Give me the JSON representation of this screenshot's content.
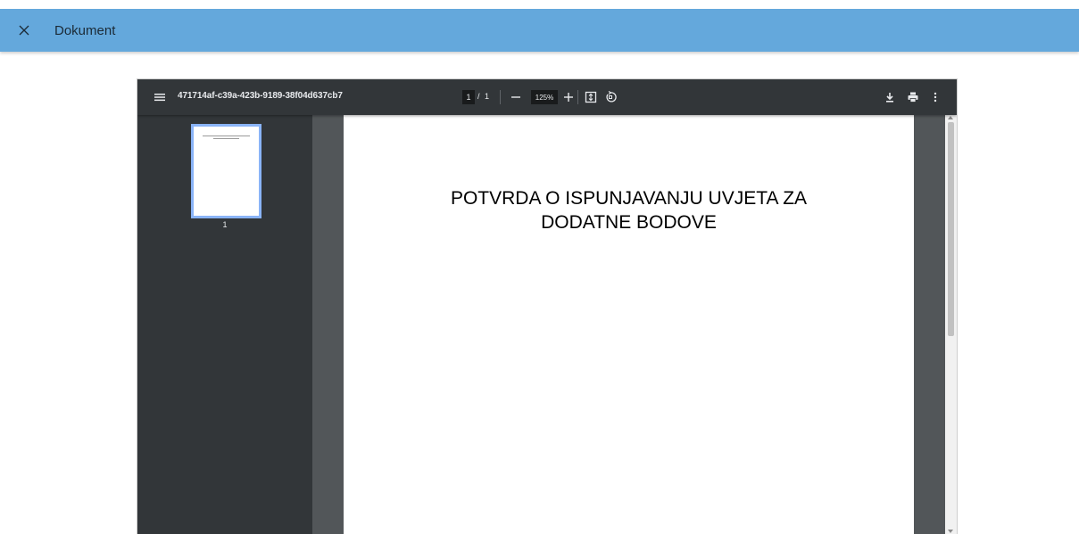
{
  "header": {
    "title": "Dokument",
    "close_icon": "close-icon",
    "background_color": "#64a8dc"
  },
  "viewer": {
    "document_name": "471714af-c39a-423b-9189-38f04d637cb7",
    "current_page": "1",
    "page_separator": "/",
    "total_pages": "1",
    "zoom": "125%",
    "icons": [
      "menu-icon",
      "zoom-out-icon",
      "zoom-in-icon",
      "fit-to-page-icon",
      "rotate-icon",
      "download-icon",
      "print-icon",
      "more-vert-icon"
    ],
    "thumbnail_label": "1"
  },
  "page": {
    "title_line1": "POTVRDA O ISPUNJAVANJU UVJETA ZA",
    "title_line2": "DODATNE BODOVE"
  }
}
